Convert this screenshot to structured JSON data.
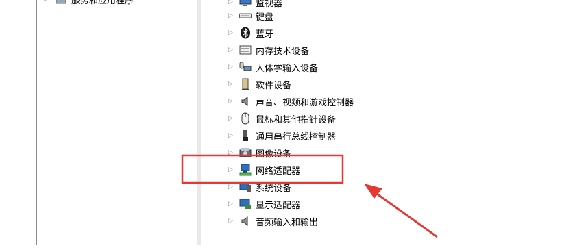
{
  "left_pane": {
    "partial_item": {
      "label": "服务和应用程序"
    }
  },
  "tree": {
    "items": [
      {
        "label": "监视器",
        "icon": "monitor-icon"
      },
      {
        "label": "键盘",
        "icon": "keyboard-icon"
      },
      {
        "label": "蓝牙",
        "icon": "bluetooth-icon"
      },
      {
        "label": "内存技术设备",
        "icon": "memory-device-icon"
      },
      {
        "label": "人体学输入设备",
        "icon": "hid-icon"
      },
      {
        "label": "软件设备",
        "icon": "software-device-icon"
      },
      {
        "label": "声音、视频和游戏控制器",
        "icon": "speaker-icon"
      },
      {
        "label": "鼠标和其他指针设备",
        "icon": "mouse-icon"
      },
      {
        "label": "通用串行总线控制器",
        "icon": "usb-icon"
      },
      {
        "label": "图像设备",
        "icon": "imaging-device-icon"
      },
      {
        "label": "网络适配器",
        "icon": "network-adapter-icon"
      },
      {
        "label": "系统设备",
        "icon": "system-device-icon"
      },
      {
        "label": "显示适配器",
        "icon": "display-adapter-icon"
      },
      {
        "label": "音频输入和输出",
        "icon": "audio-io-icon"
      }
    ]
  },
  "annotation": {
    "highlight_color": "#e53935",
    "arrow_color": "#e53935"
  }
}
